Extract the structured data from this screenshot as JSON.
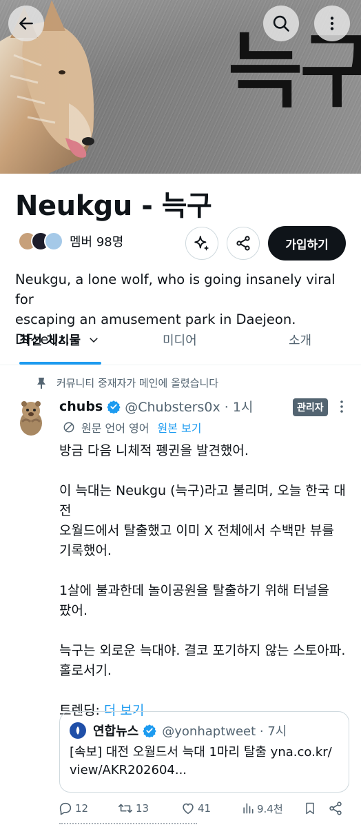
{
  "banner": {
    "text": "늑구"
  },
  "community": {
    "title": "Neukgu - 늑구",
    "members_label": "멤버 98명",
    "join_label": "가입하기",
    "description_line1": "Neukgu, a lone wolf, who is going insanely viral for",
    "description_line2": "escaping an amusement park in Daejeon. DFzeUz..."
  },
  "tabs": {
    "latest": "최신 게시물",
    "media": "미디어",
    "about": "소개"
  },
  "post": {
    "pinned_label": "커뮤니티 중재자가 메인에 올렸습니다",
    "author": "chubs",
    "handle": "@Chubsters0x · 1시",
    "mod_badge": "관리자",
    "translation_note": "원문 언어 영어",
    "show_original": "원본 보기",
    "para1": "방금 다음 니체적 펭귄을 발견했어.",
    "para2": "이 늑대는 Neukgu (늑구)라고 불리며, 오늘 한국 대전\n오월드에서 탈출했고 이미 X 전체에서 수백만 뷰를\n기록했어.",
    "para3": "1살에 불과한데 놀이공원을 탈출하기 위해 터널을\n팠어.",
    "para4": "늑구는 외로운 늑대야. 결코 포기하지 않는 스토아파.\n홀로서기.",
    "trending_label": "트렌딩: ",
    "trending_more": "더 보기"
  },
  "quote": {
    "author": "연합뉴스",
    "handle": "@yonhaptweet · 7시",
    "text_line1": "[속보] 대전 오월드서 늑대 1마리 탈출 yna.co.kr/",
    "text_line2": "view/AKR202604..."
  },
  "actions": {
    "replies": "12",
    "reposts": "13",
    "likes": "41",
    "views": "9.4천"
  },
  "colors": {
    "accent": "#1d9bf0",
    "text": "#0f1419",
    "secondary": "#536471",
    "join_bg": "#0f1419"
  }
}
